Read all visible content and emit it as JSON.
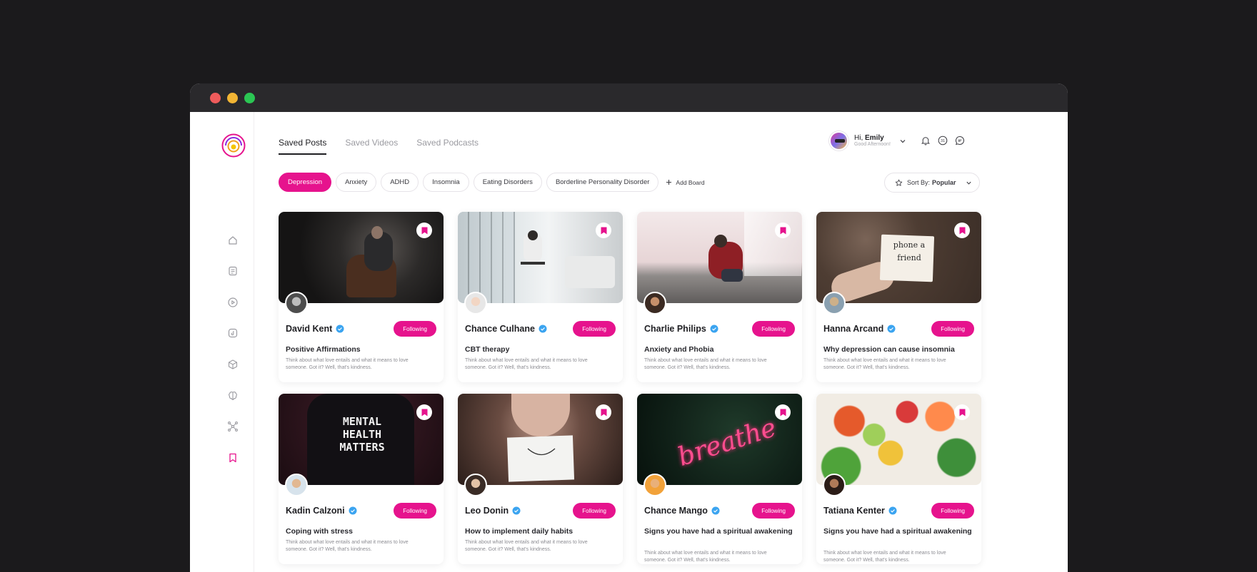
{
  "window": {
    "controls": [
      "close",
      "minimize",
      "maximize"
    ]
  },
  "brand": {
    "accent": "#e6138d",
    "logo_icon": "concentric-circles-logo"
  },
  "sidebar": {
    "items": [
      {
        "icon": "home-icon",
        "active": false
      },
      {
        "icon": "document-icon",
        "active": false
      },
      {
        "icon": "play-icon",
        "active": false
      },
      {
        "icon": "podcast-icon",
        "active": false
      },
      {
        "icon": "box-icon",
        "active": false
      },
      {
        "icon": "brain-icon",
        "active": false
      },
      {
        "icon": "network-icon",
        "active": false
      },
      {
        "icon": "bookmark-icon",
        "active": true
      }
    ]
  },
  "tabs": [
    {
      "label": "Saved Posts",
      "active": true
    },
    {
      "label": "Saved Videos",
      "active": false
    },
    {
      "label": "Saved Podcasts",
      "active": false
    }
  ],
  "user": {
    "greeting": "Hi,",
    "name": "Emily",
    "subtitle": "Good Afternoon!"
  },
  "header_icons": [
    "bell-icon",
    "calendar-icon",
    "chat-icon"
  ],
  "calendar_day": "31",
  "chips": [
    {
      "label": "Depression",
      "active": true
    },
    {
      "label": "Anxiety",
      "active": false
    },
    {
      "label": "ADHD",
      "active": false
    },
    {
      "label": "Insomnia",
      "active": false
    },
    {
      "label": "Eating Disorders",
      "active": false
    },
    {
      "label": "Borderline Personality Disorder",
      "active": false
    }
  ],
  "add_board": "Add Board",
  "sort": {
    "label": "Sort By:",
    "value": "Popular"
  },
  "cards": [
    {
      "author": "David Kent",
      "follow": "Following",
      "title": "Positive Affirmations",
      "desc": "Think about what love entails and what it means to love someone. Got it? Well, that's kindness."
    },
    {
      "author": "Chance Culhane",
      "follow": "Following",
      "title": "CBT therapy",
      "desc": "Think about what love entails and what it means to love someone. Got it? Well, that's kindness."
    },
    {
      "author": "Charlie Philips",
      "follow": "Following",
      "title": "Anxiety and Phobia",
      "desc": "Think about what love entails and what it means to love someone. Got it? Well, that's kindness."
    },
    {
      "author": "Hanna Arcand",
      "follow": "Following",
      "title": "Why depression can cause insomnia",
      "desc": "Think about what love entails and what it means to love someone. Got it? Well, that's kindness.",
      "image_text": [
        "phone a",
        "friend"
      ]
    },
    {
      "author": "Kadin Calzoni",
      "follow": "Following",
      "title": "Coping with stress",
      "desc": "Think about what love entails and what it means to love someone. Got it? Well, that's kindness.",
      "image_text": [
        "MENTAL",
        "HEALTH",
        "MATTERS"
      ]
    },
    {
      "author": "Leo Donin",
      "follow": "Following",
      "title": "How to implement daily habits",
      "desc": "Think about what love entails and what it means to love someone. Got it? Well, that's kindness."
    },
    {
      "author": "Chance Mango",
      "follow": "Following",
      "title": "Signs you have had a spiritual awakening",
      "desc": "Think about what love entails and what it means to love someone. Got it? Well, that's kindness.",
      "image_text": [
        "breathe"
      ]
    },
    {
      "author": "Tatiana Kenter",
      "follow": "Following",
      "title": "Signs you have had a spiritual awakening",
      "desc": "Think about what love entails and what it means to love someone. Got it? Well, that's kindness."
    }
  ]
}
